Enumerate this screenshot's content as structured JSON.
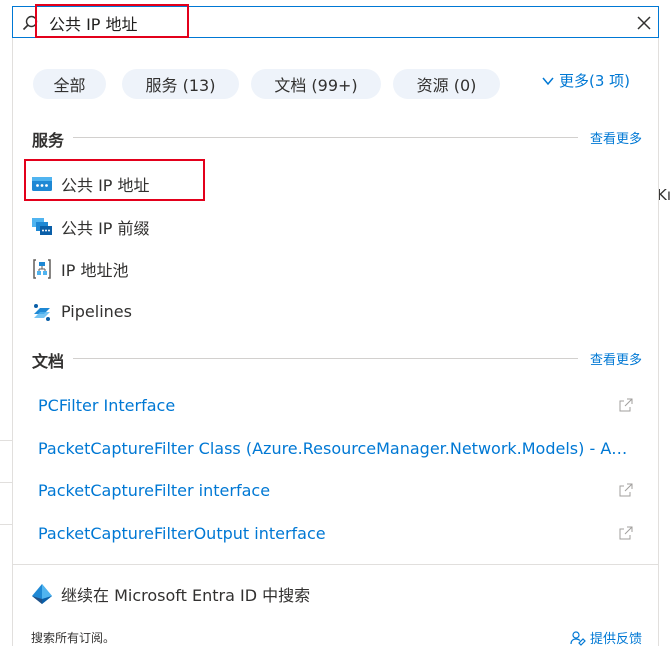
{
  "search": {
    "query": "公共 IP 地址"
  },
  "filters": [
    {
      "label": "全部"
    },
    {
      "label": "服务  (13)"
    },
    {
      "label": "文档  (99+)"
    },
    {
      "label": "资源  (0)"
    }
  ],
  "more_filters": "更多(3 项)",
  "services": {
    "heading": "服务",
    "see_more": "查看更多",
    "items": [
      {
        "label": "公共 IP 地址",
        "icon": "public-ip-address-icon"
      },
      {
        "label": "公共 IP 前缀",
        "icon": "public-ip-prefix-icon"
      },
      {
        "label": "IP 地址池",
        "icon": "ip-address-pool-icon"
      },
      {
        "label": "Pipelines",
        "icon": "pipelines-icon"
      }
    ]
  },
  "docs": {
    "heading": "文档",
    "see_more": "查看更多",
    "items": [
      {
        "label": "PCFilter Interface"
      },
      {
        "label": "PacketCaptureFilter Class (Azure.ResourceManager.Network.Models) - Azure for .NET Developers"
      },
      {
        "label": "PacketCaptureFilter interface"
      },
      {
        "label": "PacketCaptureFilterOutput interface"
      }
    ]
  },
  "entra_search": "继续在 Microsoft Entra ID 中搜索",
  "footer_note": "搜索所有订阅。",
  "feedback": "提供反馈",
  "background_fragment": "Kı",
  "colors": {
    "accent": "#0078d4",
    "pill_bg": "#eef3fa",
    "highlight": "#e3001b"
  }
}
